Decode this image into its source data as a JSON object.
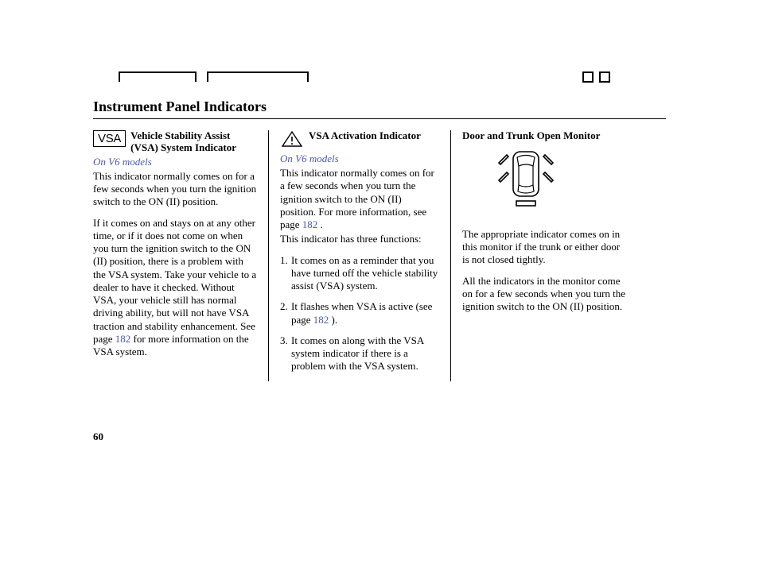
{
  "page": {
    "title": "Instrument Panel Indicators",
    "number": "60"
  },
  "col1": {
    "icon_text": "VSA",
    "heading": "Vehicle Stability Assist (VSA) System Indicator",
    "subhead": "On V6 models",
    "p1": "This indicator normally comes on for a few seconds when you turn the ignition switch to the ON (II) position.",
    "p2a": "If it comes on and stays on at any other time, or if it does not come on when you turn the ignition switch to the ON (II) position, there is a problem with the VSA system. Take your vehicle to a dealer to have it checked. Without VSA, your vehicle still has normal driving ability, but will not have VSA traction and stability enhancement. See page ",
    "p2_link": "182",
    "p2b": " for more information on the VSA system."
  },
  "col2": {
    "heading": "VSA Activation Indicator",
    "subhead": "On V6 models",
    "p1a": "This indicator normally comes on for a few seconds when you turn the ignition switch to the ON (II) position. For more information, see page ",
    "p1_link": "182",
    "p1b": " .",
    "p2": "This indicator has three functions:",
    "li1": "It comes on as a reminder that you have turned off the vehicle stability assist (VSA) system.",
    "li2a": "It flashes when VSA is active (see page ",
    "li2_link": "182",
    "li2b": " ).",
    "li3": "It comes on along with the VSA system indicator if there is a problem with the VSA system."
  },
  "col3": {
    "heading": "Door and Trunk Open Monitor",
    "p1": "The appropriate indicator comes on in this monitor if the trunk or either door is not closed tightly.",
    "p2": "All the indicators in the monitor come on for a few seconds when you turn the ignition switch to the ON (II) position."
  }
}
